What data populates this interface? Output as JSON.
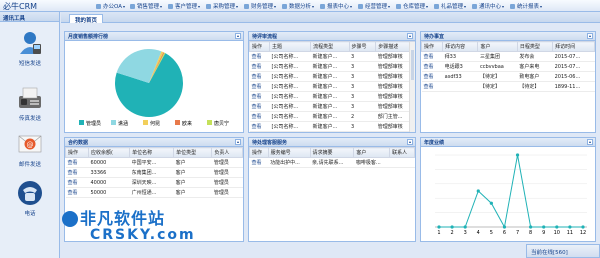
{
  "app": {
    "title": "必牛CRM"
  },
  "menu": [
    {
      "label": "办公OA",
      "x": 96
    },
    {
      "label": "销售管理",
      "x": 130
    },
    {
      "label": "客户管理",
      "x": 168
    },
    {
      "label": "采购管理",
      "x": 206
    },
    {
      "label": "财务管理",
      "x": 244
    },
    {
      "label": "数据分析",
      "x": 282
    },
    {
      "label": "报表中心",
      "x": 320
    },
    {
      "label": "经营管理",
      "x": 358
    },
    {
      "label": "仓库管理",
      "x": 396
    },
    {
      "label": "礼品管理",
      "x": 434
    },
    {
      "label": "通讯中心",
      "x": 472
    },
    {
      "label": "统计报表",
      "x": 510
    }
  ],
  "sidebar": {
    "title": "通讯工具",
    "tools": [
      {
        "label": "短信发送"
      },
      {
        "label": "传真发送"
      },
      {
        "label": "邮件发送"
      },
      {
        "label": "电话"
      }
    ]
  },
  "tab": {
    "label": "我的首页"
  },
  "panels": {
    "sales_rank": {
      "title": "月度销售额排行榜",
      "legend": [
        "管理员",
        "谯涵",
        "何昆",
        "欧来",
        "唐贝宁"
      ]
    },
    "approval": {
      "title": "待评审流程",
      "columns": [
        "操作",
        "主题",
        "流程类型",
        "步骤号",
        "步骤描述"
      ],
      "rows": [
        [
          "查看",
          "[公司名称...",
          "新建客户...",
          "3",
          "管理部审核"
        ],
        [
          "查看",
          "[公司名称...",
          "新建客户...",
          "3",
          "管理部审核"
        ],
        [
          "查看",
          "[公司名称...",
          "新建客户...",
          "3",
          "管理部审核"
        ],
        [
          "查看",
          "[公司名称...",
          "新建客户...",
          "3",
          "管理部审核"
        ],
        [
          "查看",
          "[公司名称...",
          "新建客户...",
          "3",
          "管理部审核"
        ],
        [
          "查看",
          "[公司名称...",
          "新建客户...",
          "3",
          "管理部审核"
        ],
        [
          "查看",
          "[公司名称...",
          "新建客户...",
          "2",
          "部门主管..."
        ],
        [
          "查看",
          "[公司名称...",
          "新建客户...",
          "3",
          "管理部审核"
        ]
      ]
    },
    "pending": {
      "title": "待办事宜",
      "columns": [
        "操作",
        "拜访内容",
        "客户",
        "日程类型",
        "拜访时间"
      ],
      "rows": [
        [
          "查看",
          "拜33",
          "三星集团",
          "发布会",
          "2015-07..."
        ],
        [
          "查看",
          "电话跟3",
          "ccbvvbaa",
          "客户来电",
          "2015-07..."
        ],
        [
          "查看",
          "asdf33",
          "【待定】",
          "致电客户",
          "2015-06..."
        ],
        [
          "查看",
          "",
          "【待定】",
          "【待定】",
          "1899-11..."
        ]
      ]
    },
    "orders": {
      "title": "合约数据",
      "columns": [
        "操作",
        "应收余额(",
        "单位名称",
        "单位类型",
        "负责人"
      ],
      "rows": [
        [
          "查看",
          "60000",
          "中国平安...",
          "客户",
          "管理员"
        ],
        [
          "查看",
          "33366",
          "东南集团...",
          "客户",
          "管理员"
        ],
        [
          "查看",
          "40000",
          "深圳天映...",
          "客户",
          "管理员"
        ],
        [
          "查看",
          "50000",
          "广州恒通...",
          "客户",
          "管理员"
        ]
      ]
    },
    "service": {
      "title": "待处理客服服务",
      "columns": [
        "操作",
        "服务编号",
        "请求摘要",
        "客户",
        "联系人"
      ],
      "rows": [
        [
          "查看",
          "功能出护中...",
          "亲,请先联系...",
          "咖啡极客...",
          ""
        ]
      ]
    },
    "annual": {
      "title": "年度业绩"
    }
  },
  "status": {
    "text": "当前在线[560]"
  },
  "watermark": {
    "cn": "非凡软件站",
    "en": "CRSKY.com"
  },
  "chart_data": [
    {
      "type": "pie",
      "title": "月度销售额排行榜",
      "labels": [
        "管理员",
        "谯涵",
        "何昆",
        "欧来",
        "唐贝宁"
      ],
      "values": [
        72,
        26,
        1,
        0.5,
        0.5
      ],
      "colors": [
        "#20b2b6",
        "#8fd8e2",
        "#f2cf5b",
        "#e8794a",
        "#c4e05a"
      ]
    },
    {
      "type": "line",
      "title": "年度业绩",
      "x": [
        1,
        2,
        3,
        4,
        5,
        6,
        7,
        8,
        9,
        10,
        11,
        12
      ],
      "values": [
        0,
        0,
        0,
        50,
        33,
        0,
        100,
        0,
        0,
        0,
        0,
        0
      ],
      "ylim": [
        0,
        100
      ],
      "color": "#20b2b6"
    }
  ]
}
